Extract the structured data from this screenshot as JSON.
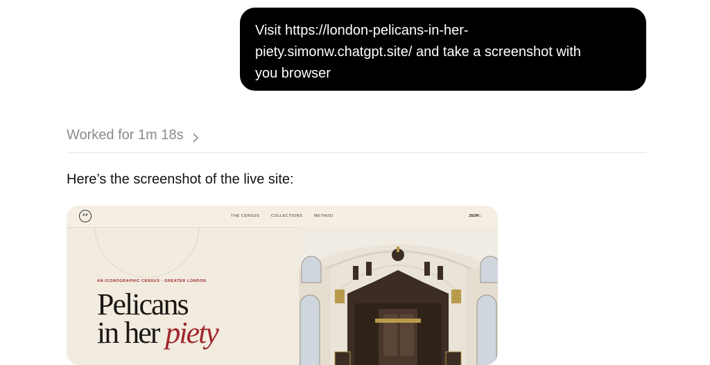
{
  "user_message": {
    "lines": [
      "Visit https://london-pelicans-in-her-",
      "piety.simonw.chatgpt.site/ and take a screenshot with",
      "you browser"
    ]
  },
  "status": {
    "worked_label": "Worked for 1m 18s",
    "chevron_icon": "chevron-right-icon"
  },
  "assistant": {
    "reply": "Here’s the screenshot of the live site:"
  },
  "screenshot": {
    "logo": "P/P",
    "nav": [
      "THE CENSUS",
      "COLLECTIONS",
      "METHOD"
    ],
    "json_label": "JSON ↓",
    "eyebrow": "AN ICONOGRAPHIC CENSUS · GREATER LONDON",
    "title_line1": "Pelicans",
    "title_line2_a": "in her ",
    "title_line2_b": "piety",
    "accent_color": "#a0262c"
  }
}
